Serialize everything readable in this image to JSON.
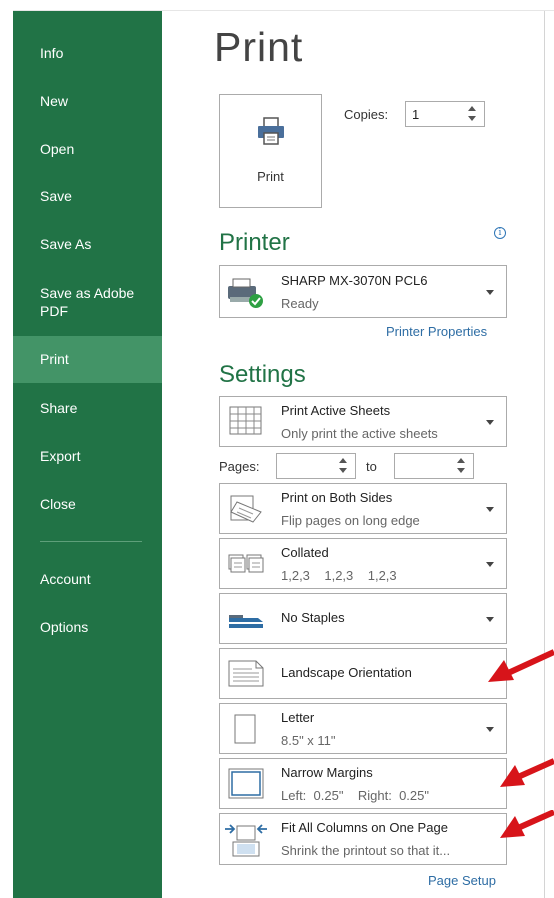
{
  "sidebar": {
    "items": [
      {
        "label": "Info"
      },
      {
        "label": "New"
      },
      {
        "label": "Open"
      },
      {
        "label": "Save"
      },
      {
        "label": "Save As"
      },
      {
        "label": "Save as Adobe PDF"
      },
      {
        "label": "Print",
        "active": true
      },
      {
        "label": "Share"
      },
      {
        "label": "Export"
      },
      {
        "label": "Close"
      },
      {
        "label": "Account"
      },
      {
        "label": "Options"
      }
    ]
  },
  "main": {
    "title": "Print",
    "print_button_label": "Print",
    "copies_label": "Copies:",
    "copies_value": "1",
    "printer": {
      "heading": "Printer",
      "name": "SHARP MX-3070N PCL6",
      "status": "Ready",
      "properties_link": "Printer Properties"
    },
    "settings": {
      "heading": "Settings",
      "sheets": {
        "title": "Print Active Sheets",
        "subtitle": "Only print the active sheets"
      },
      "pages_label": "Pages:",
      "to_label": "to",
      "pages_from": "",
      "pages_to": "",
      "sides": {
        "title": "Print on Both Sides",
        "subtitle": "Flip pages on long edge"
      },
      "collation": {
        "title": "Collated",
        "subtitle": "1,2,3    1,2,3    1,2,3"
      },
      "staples": {
        "title": "No Staples"
      },
      "orientation": {
        "title": "Landscape Orientation"
      },
      "paper": {
        "title": "Letter",
        "subtitle": "8.5\" x 11\""
      },
      "margins": {
        "title": "Narrow Margins",
        "subtitle": "Left:  0.25\"    Right:  0.25\""
      },
      "scaling": {
        "title": "Fit All Columns on One Page",
        "subtitle": "Shrink the printout so that it..."
      },
      "page_setup_link": "Page Setup"
    }
  },
  "colors": {
    "sidebar_bg": "#217346",
    "sidebar_active": "#439467",
    "heading_green": "#217346",
    "link_blue": "#2e6da4",
    "annotation_red": "#d7141a"
  }
}
